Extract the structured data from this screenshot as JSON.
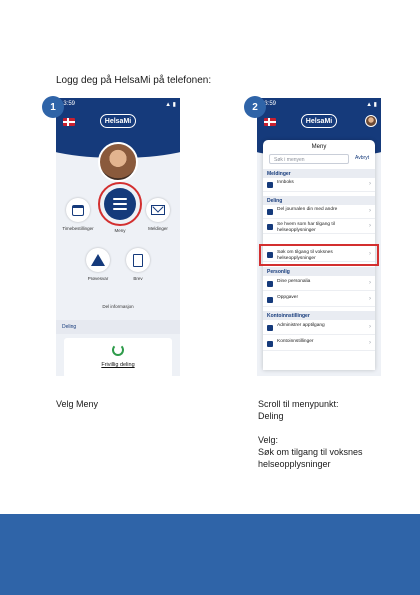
{
  "heading": "Logg deg på HelsaMi på telefonen:",
  "step1": {
    "number": "1",
    "status_time": "13:59",
    "status_signal": "▲ ▮",
    "logo": "HelsaMi",
    "tiles": [
      {
        "label": "Timebestillinger",
        "icon": "calendar-icon"
      },
      {
        "label": "Meny",
        "icon": "menu-icon"
      },
      {
        "label": "Meldinger",
        "icon": "mail-icon"
      },
      {
        "label": "Prøvesvar",
        "icon": "flask-icon"
      },
      {
        "label": "Brev",
        "icon": "document-icon"
      }
    ],
    "footer_link": "Del informasjon",
    "deling_label": "Deling",
    "card_title": "Frivillig deling"
  },
  "step2": {
    "number": "2",
    "status_time": "13:59",
    "status_signal": "▲ ▮",
    "logo": "HelsaMi",
    "sheet_title": "Meny",
    "search_placeholder": "Søk i menyen",
    "close_label": "Avbryt",
    "sections": [
      {
        "title": "Meldinger",
        "rows": [
          "Innboks"
        ]
      },
      {
        "title": "Deling",
        "rows": [
          "Del journalen din med andre",
          "Se hvem som har tilgang til helseopplysninger",
          "Søk om tilgang til voksnes helseopplysninger"
        ]
      },
      {
        "title": "Personlig",
        "rows": [
          "Dine personalia",
          "Oppgaver"
        ]
      },
      {
        "title": "Kontoinnstillinger",
        "rows": [
          "Administrer apptilgang",
          "Kontoinnstillinger"
        ]
      }
    ]
  },
  "caption_left": "Velg Meny",
  "caption_right": "Scroll til menypunkt:\nDeling\n\nVelg:\nSøk om tilgang til voksnes\nhelseopplysninger",
  "colors": {
    "brand_dark": "#153a7b",
    "badge": "#2f64a8",
    "highlight": "#d32f2f"
  }
}
